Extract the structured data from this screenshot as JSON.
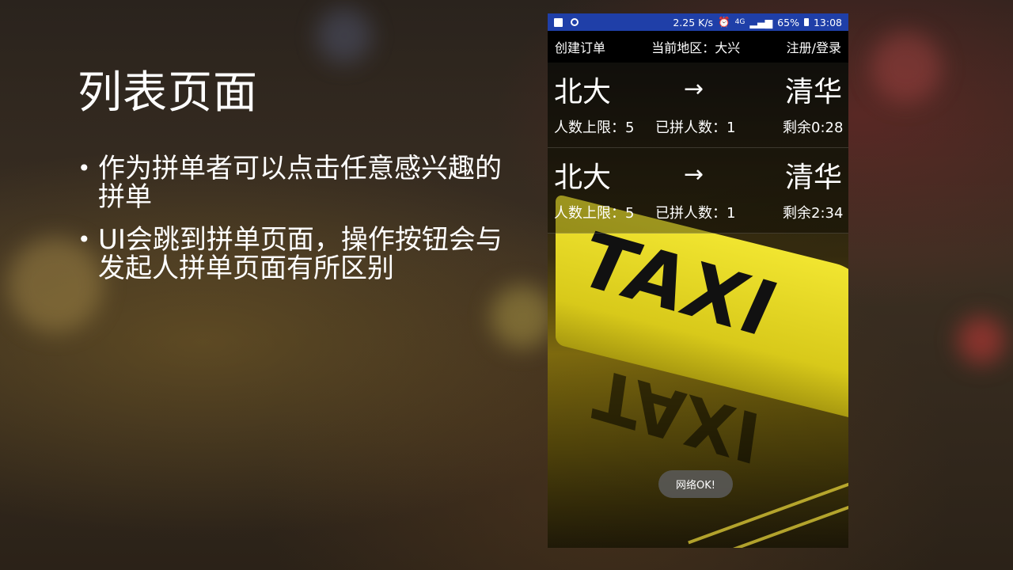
{
  "slide": {
    "title": "列表页面",
    "bullets": [
      "作为拼单者可以点击任意感兴趣的拼单",
      "UI会跳到拼单页面，操作按钮会与发起人拼单页面有所区别"
    ]
  },
  "status_bar": {
    "speed": "2.25 K/s",
    "signal": "4G",
    "battery": "65%",
    "time": "13:08"
  },
  "app_bar": {
    "create_order": "创建订单",
    "region": "当前地区：大兴",
    "login": "注册/登录"
  },
  "orders": [
    {
      "from": "北大",
      "arrow": "→",
      "to": "清华",
      "limit": "人数上限：5",
      "joined": "已拼人数：1",
      "remaining": "剩余0:28"
    },
    {
      "from": "北大",
      "arrow": "→",
      "to": "清华",
      "limit": "人数上限：5",
      "joined": "已拼人数：1",
      "remaining": "剩余2:34"
    }
  ],
  "background_sign": "TAXI",
  "toast": "网络OK!",
  "colors": {
    "status_bar": "#1f3fa8",
    "taxi_yellow": "#f1e530"
  }
}
